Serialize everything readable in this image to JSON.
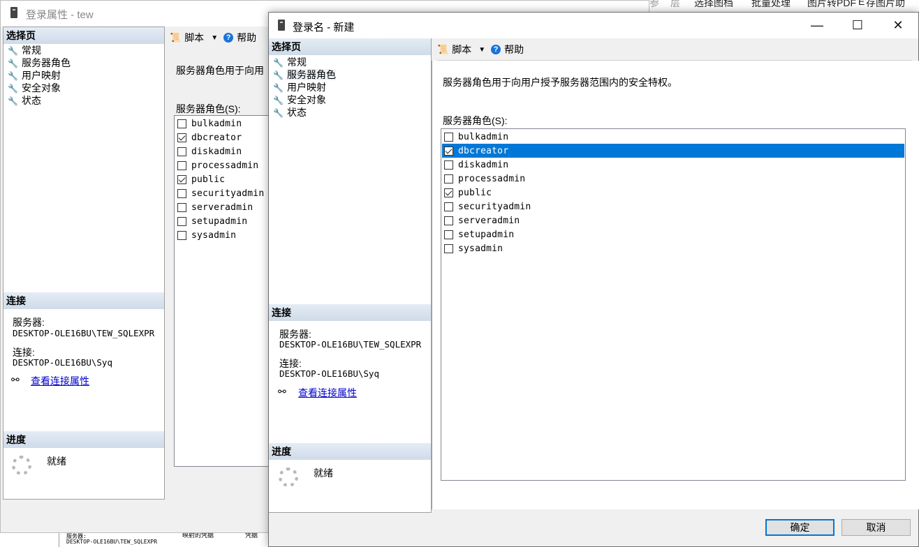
{
  "background": {
    "menu_items": [
      "参",
      "层",
      "选择图档",
      "批量处理",
      "图片转PDF",
      "E",
      "存图片助"
    ],
    "bottom_server_label": "服务器:",
    "bottom_server_value": "DESKTOP-OLE16BU\\TEW_SQLEXPR",
    "bottom_text_a": "映射的凭据",
    "bottom_text_b": "凭据"
  },
  "back_window": {
    "title": "登录属性 - tew",
    "select_page_header": "选择页",
    "nav": [
      "常规",
      "服务器角色",
      "用户映射",
      "安全对象",
      "状态"
    ],
    "toolbar_script": "脚本",
    "toolbar_help": "帮助",
    "description": "服务器角色用于向用",
    "roles_label": "服务器角色(S):",
    "roles": [
      {
        "name": "bulkadmin",
        "checked": false
      },
      {
        "name": "dbcreator",
        "checked": true
      },
      {
        "name": "diskadmin",
        "checked": false
      },
      {
        "name": "processadmin",
        "checked": false
      },
      {
        "name": "public",
        "checked": true
      },
      {
        "name": "securityadmin",
        "checked": false
      },
      {
        "name": "serveradmin",
        "checked": false
      },
      {
        "name": "setupadmin",
        "checked": false
      },
      {
        "name": "sysadmin",
        "checked": false
      }
    ],
    "connection_header": "连接",
    "server_label": "服务器:",
    "server_value": "DESKTOP-OLE16BU\\TEW_SQLEXPR",
    "conn_label": "连接:",
    "conn_value": "DESKTOP-OLE16BU\\Syq",
    "view_conn_link": "查看连接属性",
    "progress_header": "进度",
    "progress_status": "就绪"
  },
  "front_window": {
    "title": "登录名 - 新建",
    "select_page_header": "选择页",
    "nav": [
      "常规",
      "服务器角色",
      "用户映射",
      "安全对象",
      "状态"
    ],
    "selected_nav_index": 1,
    "toolbar_script": "脚本",
    "toolbar_help": "帮助",
    "description": "服务器角色用于向用户授予服务器范围内的安全特权。",
    "roles_label": "服务器角色(S):",
    "roles": [
      {
        "name": "bulkadmin",
        "checked": false,
        "selected": false
      },
      {
        "name": "dbcreator",
        "checked": true,
        "selected": true
      },
      {
        "name": "diskadmin",
        "checked": false,
        "selected": false
      },
      {
        "name": "processadmin",
        "checked": false,
        "selected": false
      },
      {
        "name": "public",
        "checked": true,
        "selected": false
      },
      {
        "name": "securityadmin",
        "checked": false,
        "selected": false
      },
      {
        "name": "serveradmin",
        "checked": false,
        "selected": false
      },
      {
        "name": "setupadmin",
        "checked": false,
        "selected": false
      },
      {
        "name": "sysadmin",
        "checked": false,
        "selected": false
      }
    ],
    "connection_header": "连接",
    "server_label": "服务器:",
    "server_value": "DESKTOP-OLE16BU\\TEW_SQLEXPR",
    "conn_label": "连接:",
    "conn_value": "DESKTOP-OLE16BU\\Syq",
    "view_conn_link": "查看连接属性",
    "progress_header": "进度",
    "progress_status": "就绪",
    "ok_button": "确定",
    "cancel_button": "取消"
  },
  "colors": {
    "selection": "#0078d7",
    "link": "#0000cc",
    "section_header": "#d5e0ec"
  }
}
